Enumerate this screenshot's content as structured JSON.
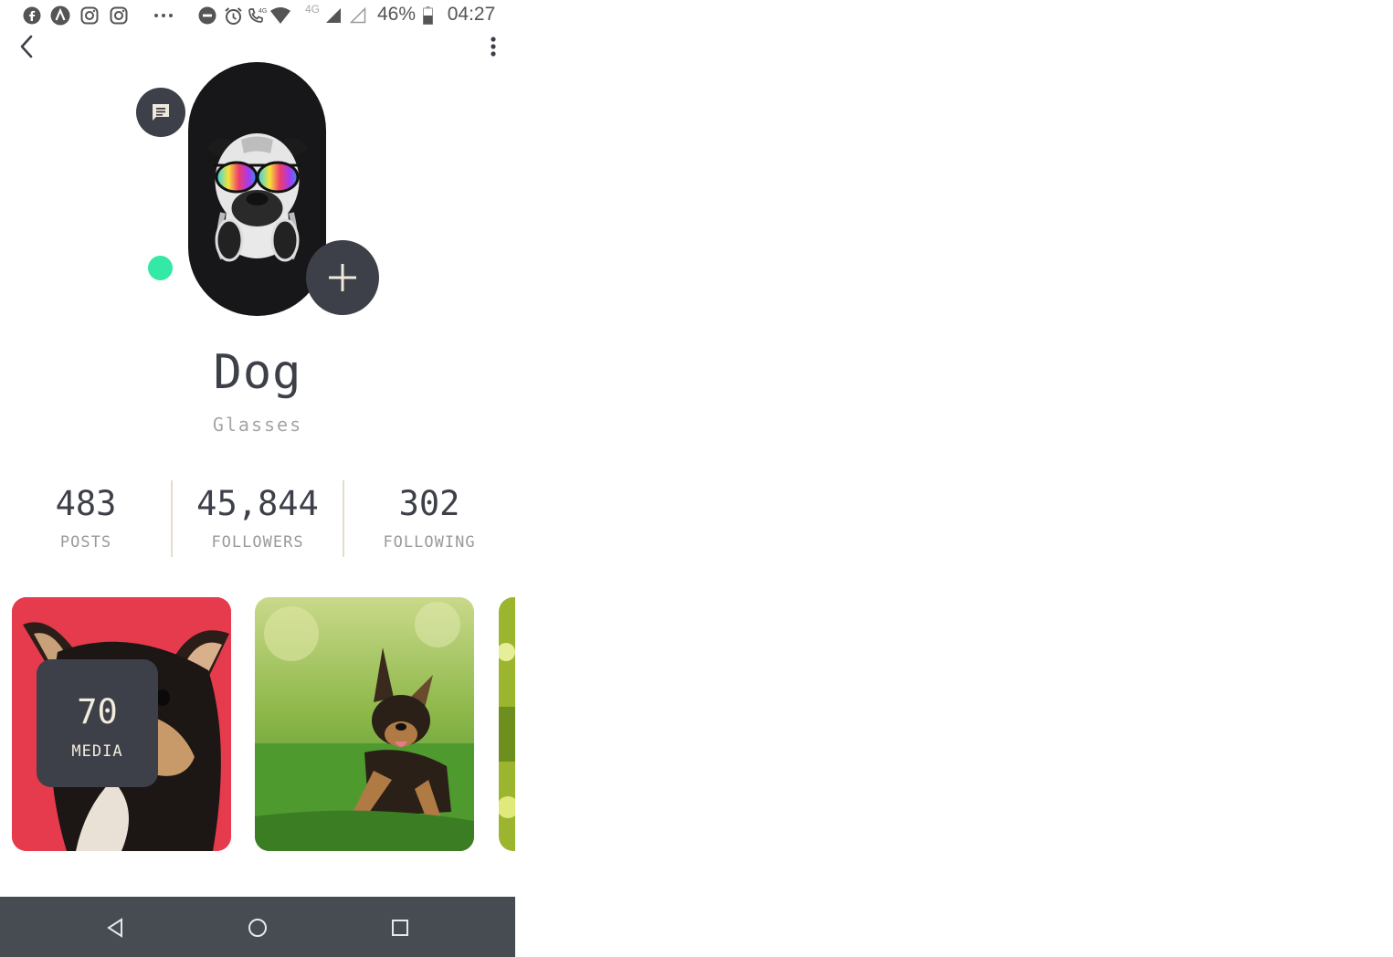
{
  "status_bar": {
    "time": "04:27",
    "battery": "46%",
    "network_label_1": "4G",
    "network_label_2": "4G",
    "icons": [
      "facebook-icon",
      "a-icon",
      "instagram-icon",
      "instagram-icon",
      "more-dots-icon",
      "do-not-disturb-icon",
      "alarm-icon",
      "volte-call-icon",
      "wifi-icon",
      "signal-icon",
      "signal-empty-icon",
      "battery-icon"
    ]
  },
  "app_bar": {
    "back_icon": "chevron-left-icon",
    "menu_icon": "more-vert-icon"
  },
  "profile": {
    "name": "Dog",
    "subtitle": "Glasses",
    "online_color": "#34e8a5"
  },
  "stats": [
    {
      "value": "483",
      "label": "POSTS"
    },
    {
      "value": "45,844",
      "label": "FOLLOWERS"
    },
    {
      "value": "302",
      "label": "FOLLOWING"
    }
  ],
  "media": {
    "count": "70",
    "label": "MEDIA"
  },
  "colors": {
    "dark": "#3d4048",
    "accent_green": "#34e8a5",
    "cream": "#f2ecdd",
    "nav_bg": "#474b52"
  }
}
